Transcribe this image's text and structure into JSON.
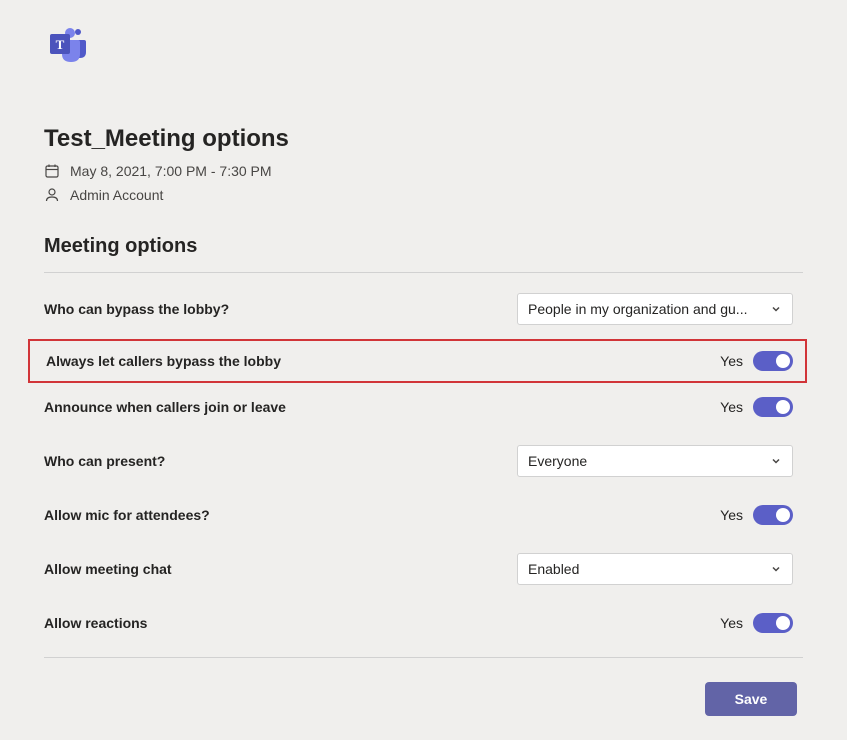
{
  "header": {
    "page_title": "Test_Meeting options",
    "datetime": "May 8, 2021, 7:00 PM - 7:30 PM",
    "organizer": "Admin Account"
  },
  "section": {
    "title": "Meeting options"
  },
  "options": {
    "bypass_lobby": {
      "label": "Who can bypass the lobby?",
      "value": "People in my organization and gu..."
    },
    "always_bypass": {
      "label": "Always let callers bypass the lobby",
      "value": "Yes"
    },
    "announce": {
      "label": "Announce when callers join or leave",
      "value": "Yes"
    },
    "who_present": {
      "label": "Who can present?",
      "value": "Everyone"
    },
    "allow_mic": {
      "label": "Allow mic for attendees?",
      "value": "Yes"
    },
    "meeting_chat": {
      "label": "Allow meeting chat",
      "value": "Enabled"
    },
    "reactions": {
      "label": "Allow reactions",
      "value": "Yes"
    }
  },
  "footer": {
    "save_label": "Save"
  }
}
